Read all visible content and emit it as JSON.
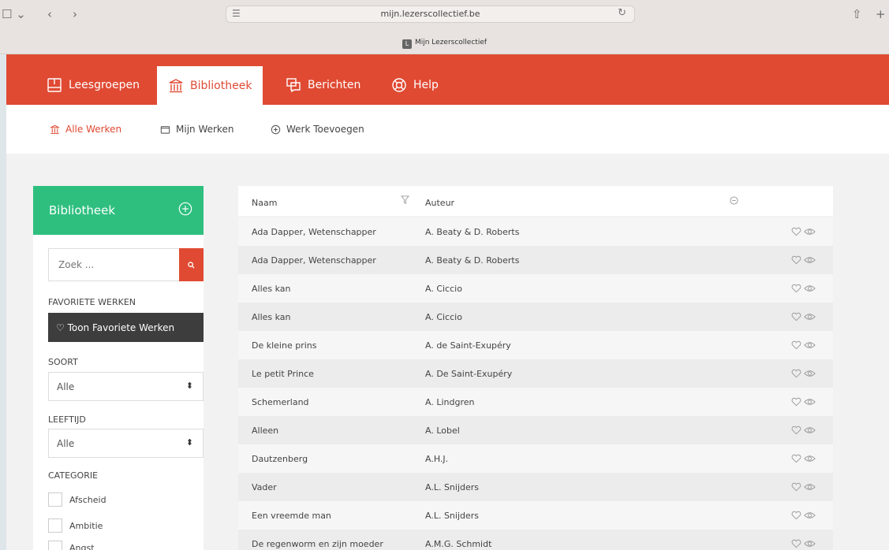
{
  "browser": {
    "url": "mijn.lezerscollectief.be",
    "tab_title": "Mijn Lezerscollectief",
    "tab_favicon": "L"
  },
  "topnav": {
    "items": [
      {
        "label": "Leesgroepen",
        "icon": "book-icon",
        "active": false
      },
      {
        "label": "Bibliotheek",
        "icon": "library-icon",
        "active": true
      },
      {
        "label": "Berichten",
        "icon": "messages-icon",
        "active": false
      },
      {
        "label": "Help",
        "icon": "lifebuoy-icon",
        "active": false
      }
    ]
  },
  "subnav": {
    "items": [
      {
        "label": "Alle Werken",
        "icon": "library-icon",
        "active": true
      },
      {
        "label": "Mijn Werken",
        "icon": "folder-icon",
        "active": false
      },
      {
        "label": "Werk Toevoegen",
        "icon": "plus-circle-icon",
        "active": false
      }
    ]
  },
  "sidebar": {
    "title": "Bibliotheek",
    "search_placeholder": "Zoek ...",
    "favorites_label": "FAVORIETE WERKEN",
    "favorites_button": "♡ Toon Favoriete Werken",
    "soort_label": "SOORT",
    "soort_value": "Alle",
    "leeftijd_label": "LEEFTIJD",
    "leeftijd_value": "Alle",
    "categorie_label": "CATEGORIE",
    "categories": [
      "Afscheid",
      "Ambitie",
      "Angst"
    ]
  },
  "table": {
    "headers": {
      "name": "Naam",
      "author": "Auteur"
    },
    "rows": [
      {
        "name": "Ada Dapper, Wetenschapper",
        "author": "A. Beaty & D. Roberts"
      },
      {
        "name": "Ada Dapper, Wetenschapper",
        "author": "A. Beaty & D. Roberts"
      },
      {
        "name": "Alles kan",
        "author": "A. Ciccio"
      },
      {
        "name": "Alles kan",
        "author": "A. Ciccio"
      },
      {
        "name": "De kleine prins",
        "author": "A. de Saint-Exupéry"
      },
      {
        "name": "Le petit Prince",
        "author": "A. De Saint-Exupéry"
      },
      {
        "name": "Schemerland",
        "author": "A. Lindgren"
      },
      {
        "name": "Alleen",
        "author": "A. Lobel"
      },
      {
        "name": "Dautzenberg",
        "author": "A.H.J."
      },
      {
        "name": "Vader",
        "author": "A.L. Snijders"
      },
      {
        "name": "Een vreemde man",
        "author": "A.L. Snijders"
      },
      {
        "name": "De regenworm en zijn moeder",
        "author": "A.M.G. Schmidt"
      }
    ]
  },
  "colors": {
    "brand_red": "#e04a33",
    "sidebar_green": "#2ebf7f",
    "dark_button": "#3d3d3d"
  }
}
